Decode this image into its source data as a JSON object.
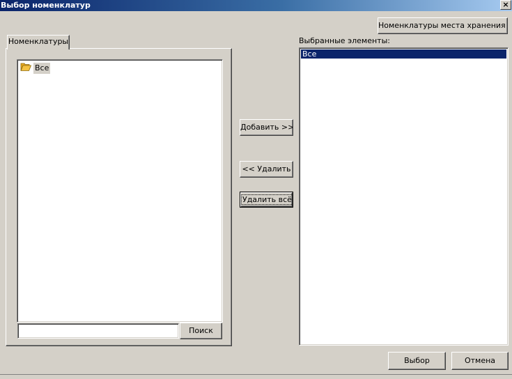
{
  "window": {
    "title": "Выбор номенклатур",
    "close_label": "×"
  },
  "top_button": {
    "label": "Номенклатуры места хранения ..."
  },
  "left_panel": {
    "tab_label": "Номенклатуры",
    "tree": [
      {
        "label": "Все",
        "icon": "folder-open-icon"
      }
    ],
    "search": {
      "value": "",
      "button_label": "Поиск"
    }
  },
  "middle_buttons": {
    "add_label": "Добавить >>",
    "remove_label": "<< Удалить",
    "remove_all_label": "Удалить всё"
  },
  "right_panel": {
    "label": "Выбранные элементы:",
    "items": [
      {
        "label": "Все",
        "selected": true
      }
    ]
  },
  "footer": {
    "ok_label": "Выбор",
    "cancel_label": "Отмена"
  },
  "colors": {
    "face": "#d4d0c8",
    "title_start": "#0a246a",
    "title_end": "#a6caf0",
    "selection": "#0a246a",
    "folder": "#f5c242"
  }
}
